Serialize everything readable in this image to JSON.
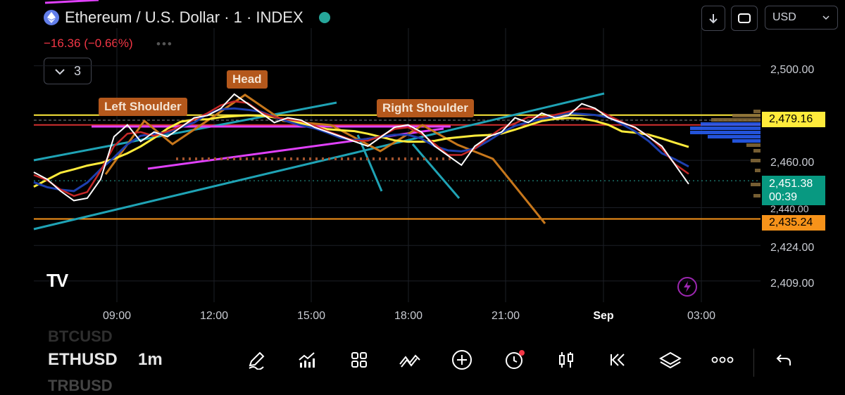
{
  "header": {
    "title": "Ethereum / U.S. Dollar · 1 · INDEX",
    "change": "−16.36 (−0.66%)",
    "indicator_count": "3",
    "currency": "USD",
    "brand_color": "#627eea",
    "live_color": "#26a69a"
  },
  "bottom": {
    "symbol": "ETHUSD",
    "symbol_prev": "BTCUSD",
    "symbol_next": "TRBUSD",
    "timeframe": "1m",
    "tools": [
      "pencil-icon",
      "indicators-icon",
      "grid-icon",
      "patterns-icon",
      "add-icon",
      "alert-icon",
      "candles-icon",
      "replay-icon",
      "layers-icon",
      "more-icon",
      "undo-icon"
    ]
  },
  "chart_data": {
    "type": "line",
    "symbol": "ETHUSD",
    "x_ticks": [
      "09:00",
      "12:00",
      "15:00",
      "18:00",
      "21:00",
      "Sep",
      "03:00"
    ],
    "y_ticks": [
      2409.0,
      2424.0,
      2440.0,
      2460.0,
      2500.0
    ],
    "y_tick_labels": [
      "2,409.00",
      "2,424.00",
      "2,440.00",
      "2,460.00",
      "2,500.00"
    ],
    "ylim": [
      2400,
      2510
    ],
    "current_price": "2,451.38",
    "countdown": "00:39",
    "levels": [
      {
        "label": "2,479.16",
        "value": 2479.16,
        "color": "#ffeb3b"
      },
      {
        "label": "2,435.24",
        "value": 2435.24,
        "color": "#f7931a"
      }
    ],
    "annotations": [
      "Left Shoulder",
      "Head",
      "Right Shoulder"
    ],
    "series": [
      {
        "values": [
          2455,
          2452,
          2447,
          2443,
          2444,
          2452,
          2470,
          2475,
          2468,
          2472,
          2470,
          2474,
          2478,
          2479,
          2482,
          2488,
          2484,
          2480,
          2476,
          2478,
          2477,
          2474,
          2472,
          2470,
          2468,
          2466,
          2470,
          2474,
          2475,
          2472,
          2466,
          2462,
          2458,
          2466,
          2470,
          2472,
          2478,
          2476,
          2480,
          2478,
          2479,
          2484,
          2482,
          2478,
          2476,
          2474,
          2470,
          2466,
          2458,
          2450
        ],
        "color": "#ffffff"
      }
    ]
  }
}
